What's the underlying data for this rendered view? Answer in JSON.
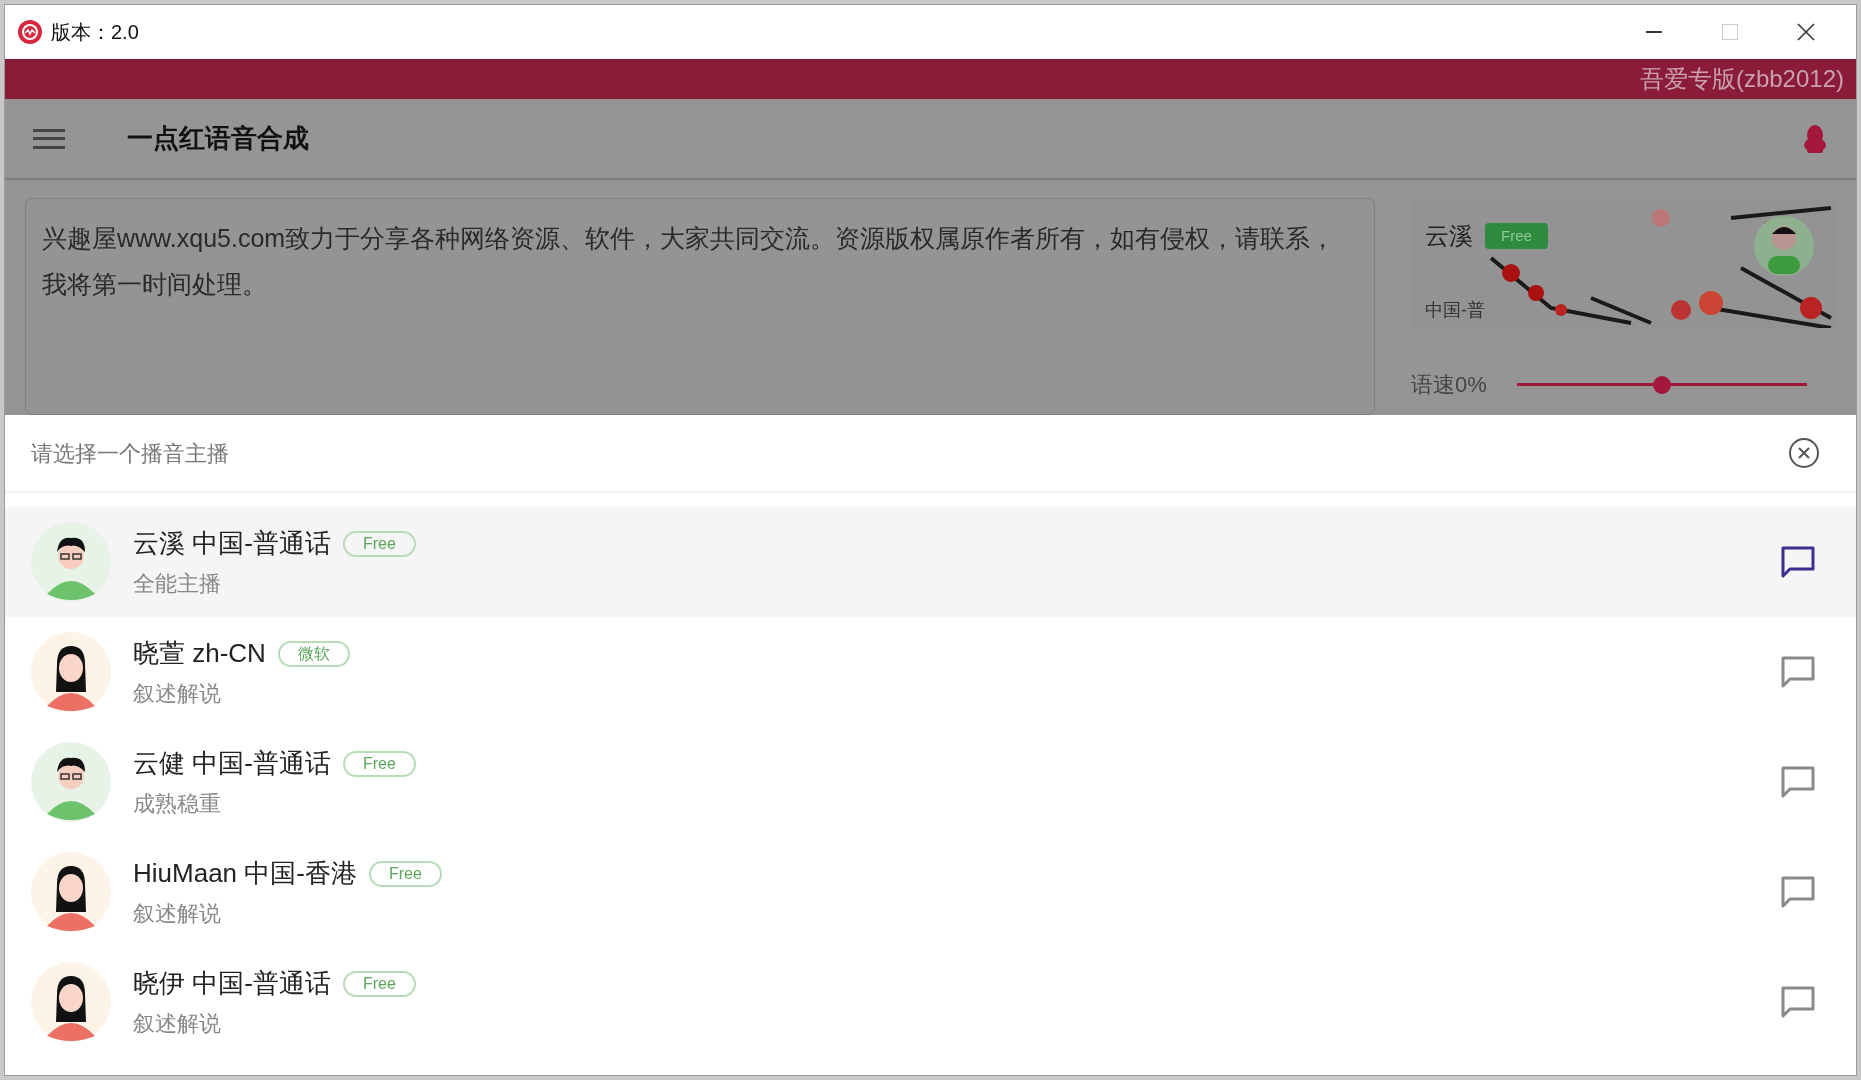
{
  "window": {
    "title": "版本：2.0"
  },
  "banner": {
    "text": "吾爱专版(zbb2012)"
  },
  "app_bar": {
    "title": "一点红语音合成"
  },
  "text_input": {
    "value": "兴趣屋www.xqu5.com致力于分享各种网络资源、软件，大家共同交流。资源版权属原作者所有，如有侵权，请联系，我将第一时间处理。"
  },
  "voice_card": {
    "name": "云溪",
    "badge": "Free",
    "locale": "中国-普"
  },
  "speed": {
    "label": "语速0%",
    "level": 0.5
  },
  "sheet": {
    "title": "请选择一个播音主播",
    "voices": [
      {
        "name": "云溪 中国-普通话",
        "badge": "Free",
        "description": "全能主播",
        "kind": "male",
        "selected": true
      },
      {
        "name": "晓萱 zh-CN",
        "badge": "微软",
        "description": "叙述解说",
        "kind": "female",
        "selected": false
      },
      {
        "name": "云健 中国-普通话",
        "badge": "Free",
        "description": "成熟稳重",
        "kind": "male",
        "selected": false
      },
      {
        "name": "HiuMaan 中国-香港",
        "badge": "Free",
        "description": "叙述解说",
        "kind": "female",
        "selected": false
      },
      {
        "name": "晓伊 中国-普通话",
        "badge": "Free",
        "description": "叙述解说",
        "kind": "female",
        "selected": false
      }
    ]
  }
}
